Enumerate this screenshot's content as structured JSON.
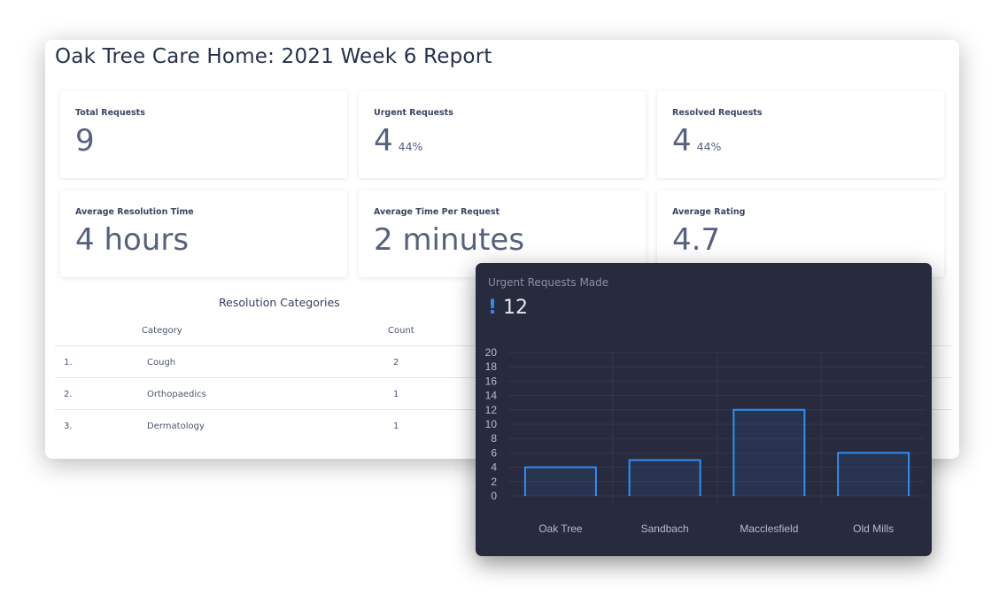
{
  "report": {
    "title": "Oak Tree Care Home: 2021 Week 6 Report",
    "stats": [
      {
        "label": "Total Requests",
        "value": "9",
        "pct": ""
      },
      {
        "label": "Urgent Requests",
        "value": "4",
        "pct": "44%"
      },
      {
        "label": "Resolved Requests",
        "value": "4",
        "pct": "44%"
      },
      {
        "label": "Average Resolution Time",
        "value": "4 hours",
        "pct": ""
      },
      {
        "label": "Average Time Per Request",
        "value": "2 minutes",
        "pct": ""
      },
      {
        "label": "Average Rating",
        "value": "4.7",
        "pct": ""
      }
    ],
    "table": {
      "title": "Resolution Categories",
      "headers": [
        "Category",
        "Count"
      ],
      "rows": [
        {
          "index": "1.",
          "category": "Cough",
          "count": "2"
        },
        {
          "index": "2.",
          "category": "Orthopaedics",
          "count": "1"
        },
        {
          "index": "3.",
          "category": "Dermatology",
          "count": "1"
        }
      ]
    }
  },
  "chart_card": {
    "heading": "Urgent Requests Made",
    "total": "12",
    "total_icon": "exclamation-icon",
    "accent_color": "#2f8ef5",
    "background_color": "#282a3d"
  },
  "chart_data": {
    "type": "bar",
    "categories": [
      "Oak Tree",
      "Sandbach",
      "Macclesfield",
      "Old Mills"
    ],
    "values": [
      4,
      5,
      12,
      6
    ],
    "title": "",
    "xlabel": "",
    "ylabel": "",
    "ylim": [
      0,
      20
    ],
    "yticks": [
      0,
      2,
      4,
      6,
      8,
      10,
      12,
      14,
      16,
      18,
      20
    ],
    "grid": true,
    "legend": "none"
  }
}
